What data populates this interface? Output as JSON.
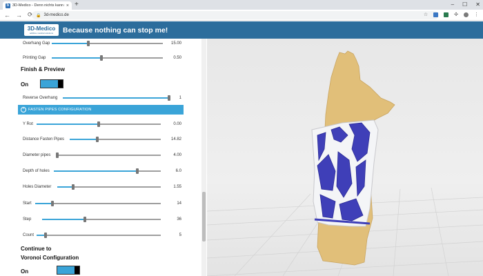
{
  "browser": {
    "tab_title": "3D-Medico - Denn nichts kann m",
    "tab_icon": "favicon",
    "url": "3d-medico.de"
  },
  "header": {
    "logo_main": "3D-Medico",
    "logo_sub": "additive medical solutions",
    "slogan": "Because nothing can stop me!",
    "background": "#2c6d9c"
  },
  "panel": {
    "top_sliders": [
      {
        "label": "Overhang Gap",
        "value": "15.00",
        "level": 0.33
      },
      {
        "label": "Printing Gap",
        "value": "0.50",
        "level": 0.45
      }
    ],
    "finish_preview": {
      "title": "Finish & Preview",
      "on_label": "On",
      "toggle_on": true,
      "reverse_overhang": {
        "label": "Reverse Overhang",
        "value": "1",
        "level": 1.0
      }
    },
    "fasten_section_title": "FASTEN PIPES CONFIGURATION",
    "fasten_sliders": [
      {
        "label": "Y Rot",
        "value": "0.00",
        "level": 0.5
      },
      {
        "label": "Distance Fasten Pipes",
        "value": "14.82",
        "level": 0.3
      },
      {
        "label": "Diameter pipes",
        "value": "4.00",
        "level": 0.0
      },
      {
        "label": "Depth of holes",
        "value": "6.0",
        "level": 0.78
      },
      {
        "label": "Holes Diameter",
        "value": "1.55",
        "level": 0.15
      },
      {
        "label": "Start",
        "value": "14",
        "level": 0.14
      },
      {
        "label": "Step",
        "value": "36",
        "level": 0.36
      },
      {
        "label": "Count",
        "value": "5",
        "level": 0.07
      }
    ],
    "voronoi": {
      "title_line1": "Continue to",
      "title_line2": "Voronoi Configuration",
      "on_label": "On",
      "toggle_on": true
    }
  },
  "colors": {
    "accent": "#3aa4d8",
    "splint_frame": "#f4f5f7",
    "splint_struts": "#3f3fb8",
    "hand": "#e1bf79"
  }
}
